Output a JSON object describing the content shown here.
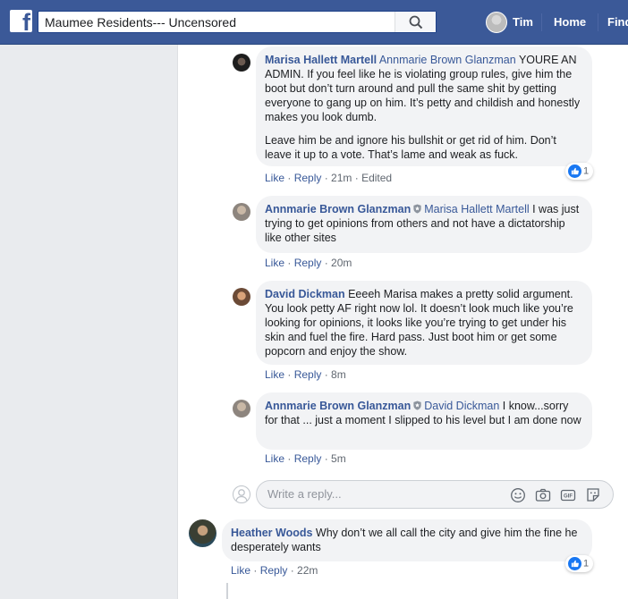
{
  "header": {
    "search_value": "Maumee Residents--- Uncensored",
    "profile_name": "Tim",
    "nav_home": "Home",
    "nav_find": "Find"
  },
  "comments": [
    {
      "author": "Marisa Hallett Martell",
      "mention": "Annmarie Brown Glanzman",
      "text": " YOURE AN ADMIN. If you feel like he is violating group rules, give him the boot but don’t turn around and pull the same shit by getting everyone to gang up on him. It’s petty and childish and honestly makes you look dumb.",
      "text2": "Leave him be and ignore his bullshit or get rid of him. Don’t leave it up to a vote. That’s lame and weak as fuck.",
      "like": "Like",
      "reply": "Reply",
      "time": "21m",
      "edited": "Edited",
      "reactions": "1"
    },
    {
      "author": "Annmarie Brown Glanzman",
      "mention": "Marisa Hallett Martell",
      "text": " I was just trying to get opinions from others and not have a dictatorship like other sites",
      "like": "Like",
      "reply": "Reply",
      "time": "20m"
    },
    {
      "author": "David Dickman",
      "text": " Eeeeh Marisa makes a pretty solid argument. You look petty AF right now lol. It doesn’t look much like you’re looking for opinions, it looks like you’re trying to get under his skin and fuel the fire. Hard pass. Just boot him or get some popcorn and enjoy the show.",
      "like": "Like",
      "reply": "Reply",
      "time": "8m"
    },
    {
      "author": "Annmarie Brown Glanzman",
      "mention": "David Dickman",
      "text": " I know...sorry for that ... just a moment I slipped to his level but I am done now",
      "like": "Like",
      "reply": "Reply",
      "time": "5m"
    },
    {
      "author": "Heather Woods",
      "text": " Why don’t we all call the city and give him the fine he desperately wants",
      "like": "Like",
      "reply": "Reply",
      "time": "22m",
      "reactions": "1"
    }
  ],
  "reply_box": {
    "placeholder": "Write a reply...",
    "icons": [
      "emoji-icon",
      "camera-icon",
      "gif-icon",
      "sticker-icon"
    ]
  },
  "colors": {
    "brand": "#3b5998",
    "link": "#385898",
    "bubble": "#f2f3f5",
    "like_blue": "#1877f2"
  }
}
